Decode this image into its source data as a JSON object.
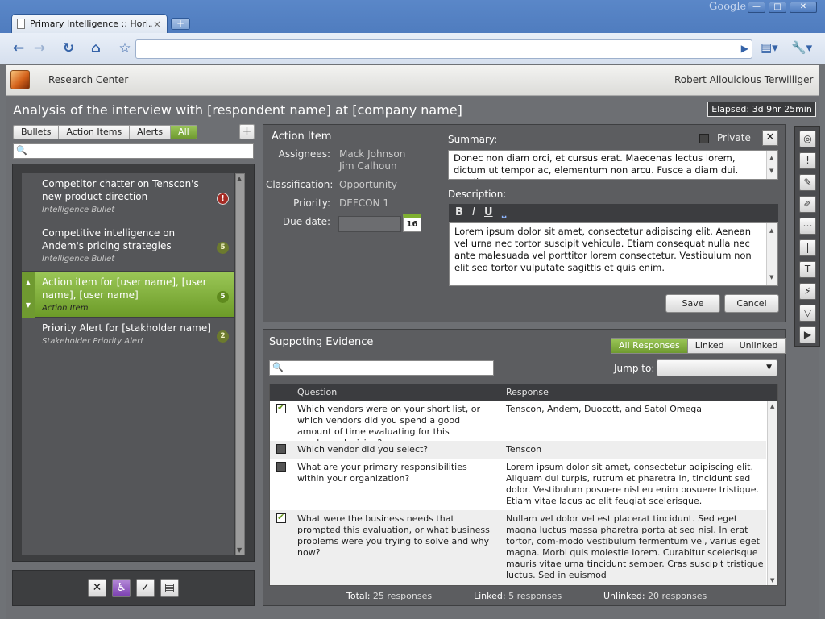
{
  "browser": {
    "tab_title": "Primary Intelligence :: Hori...",
    "tab_close": "×",
    "new_tab": "+",
    "brand": "Google",
    "win_min": "—",
    "win_max": "□",
    "win_close": "✕"
  },
  "app": {
    "title": "Research Center",
    "user": "Robert Allouicious Terwilliger"
  },
  "page": {
    "title": "Analysis of the interview with [respondent name] at [company name]",
    "elapsed": "Elapsed:  3d 9hr 25min"
  },
  "filters": [
    "Bullets",
    "Action Items",
    "Alerts",
    "All"
  ],
  "add_label": "+",
  "list": [
    {
      "title": "Competitor chatter on Tenscon's new product direction",
      "type": "Intelligence Bullet",
      "badge": "!"
    },
    {
      "title": "Competitive intelligence on Andem's pricing strategies",
      "type": "Intelligence Bullet",
      "badge": "5"
    },
    {
      "title": "Action item for [user name], [user name], [user name]",
      "type": "Action Item",
      "badge": "5"
    },
    {
      "title": "Priority Alert for [stakholder name]",
      "type": "Stakeholder Priority Alert",
      "badge": "2"
    }
  ],
  "action_item": {
    "heading": "Action Item",
    "assignees_label": "Assignees:",
    "assignees": [
      "Mack Johnson",
      "Jim Calhoun"
    ],
    "classification_label": "Classification:",
    "classification": "Opportunity",
    "priority_label": "Priority:",
    "priority": "DEFCON 1",
    "due_label": "Due date:",
    "calendar_day": "16",
    "summary_label": "Summary:",
    "private_label": "Private",
    "summary": "Donec non diam orci, et cursus erat. Maecenas lectus lorem, dictum ut tempor ac, elementum non arcu. Fusce a diam dui. condimentum",
    "description_label": "Description:",
    "description": "Lorem ipsum dolor sit amet, consectetur adipiscing elit. Aenean vel urna nec tortor suscipit vehicula. Etiam consequat nulla nec ante malesuada vel porttitor lorem consectetur. Vestibulum non elit sed tortor vulputate sagittis et quis enim.",
    "save": "Save",
    "cancel": "Cancel"
  },
  "evidence": {
    "heading": "Suppoting Evidence",
    "tabs": [
      "All Responses",
      "Linked",
      "Unlinked"
    ],
    "jump_label": "Jump to:",
    "col_question": "Question",
    "col_response": "Response",
    "rows": [
      {
        "checked": true,
        "q": "Which vendors were on your short list, or which vendors did you spend a good amount of time evaluating for this purchase decision?",
        "r": "Tenscon, Andem, Duocott, and Satol Omega"
      },
      {
        "checked": false,
        "q": "Which vendor did you select?",
        "r": "Tenscon"
      },
      {
        "checked": false,
        "q": "What are your primary responsibilities within your organization?",
        "r": "Lorem ipsum dolor sit amet, consectetur adipiscing elit. Aliquam dui turpis, rutrum et pharetra in, tincidunt sed dolor. Vestibulum posuere nisl eu enim posuere tristique. Etiam vitae lacus ac elit feugiat scelerisque."
      },
      {
        "checked": true,
        "q": "What were the business needs that prompted this evaluation, or what business problems were you trying to solve and why now?",
        "r": "Nullam vel dolor vel est placerat tincidunt. Sed eget magna luctus massa pharetra porta at sed nisl. In erat tortor, com-modo vestibulum fermentum vel, varius eget magna. Morbi quis molestie lorem. Curabitur scelerisque mauris vitae urna tincidunt semper. Cras suscipit tristique luctus. Sed in euismod"
      }
    ],
    "total_label": "Total:",
    "total": "25 responses",
    "linked_label": "Linked:",
    "linked": "5 responses",
    "unlinked_label": "Unlinked:",
    "unlinked": "20 responses"
  },
  "icons": {
    "search": "🔍",
    "back": "←",
    "forward": "→",
    "reload": "↻",
    "home": "⌂",
    "star": "☆",
    "go": "▶",
    "page": "▤▾",
    "wrench": "🔧▾",
    "close": "✕",
    "bold": "B",
    "italic": "I",
    "underline": "U",
    "strike": "⎵",
    "up": "▲",
    "down": "▼",
    "bb_cancel": "✕",
    "bb_person": "♿",
    "bb_check": "✓",
    "bb_doc": "▤"
  },
  "colors": {
    "accent_green": "#7fb030",
    "alert_red": "#a52a23",
    "chrome_blue": "#4572b6"
  }
}
